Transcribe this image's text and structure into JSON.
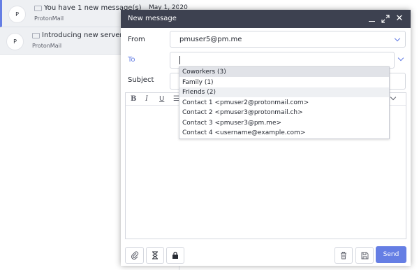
{
  "inbox": {
    "rows": [
      {
        "avatar": "P",
        "subject": "You have 1 new message(s)",
        "sender": "ProtonMail",
        "date": "May 1, 2020"
      },
      {
        "avatar": "P",
        "subject": "Introducing new servers, fe",
        "sender": "ProtonMail",
        "date": ""
      }
    ]
  },
  "composer": {
    "title": "New message",
    "from_label": "From",
    "from_value": "pmuser5@pm.me",
    "to_label": "To",
    "subject_label": "Subject",
    "toolbar": {
      "bold": "B",
      "italic": "I",
      "underline": "U",
      "list": "☰"
    },
    "send_label": "Send"
  },
  "autocomplete": [
    "Coworkers (3)",
    "Family (1)",
    "Friends (2)",
    "Contact 1 <pmuser2@protonmail.com>",
    "Contact 2 <pmuser3@protonmail.ch>",
    "Contact 3 <pmuser3@pm.me>",
    "Contact 4 <username@example.com>"
  ],
  "colors": {
    "header": "#3d4150",
    "accent": "#657ee4"
  }
}
